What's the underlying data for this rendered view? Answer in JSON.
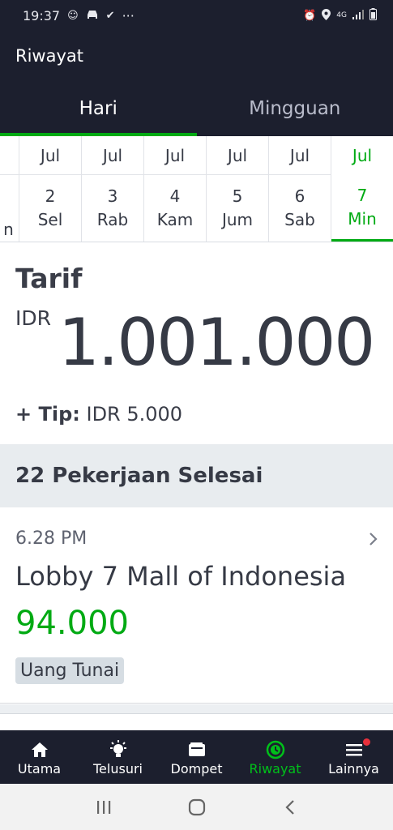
{
  "status_bar": {
    "time": "19:37",
    "more": "···",
    "network": "4G"
  },
  "app_bar": {
    "title": "Riwayat"
  },
  "tabs": [
    {
      "label": "Hari",
      "active": true
    },
    {
      "label": "Mingguan",
      "active": false
    }
  ],
  "dates": [
    {
      "month": "",
      "day": "",
      "weekday": "n"
    },
    {
      "month": "Jul",
      "day": "2",
      "weekday": "Sel"
    },
    {
      "month": "Jul",
      "day": "3",
      "weekday": "Rab"
    },
    {
      "month": "Jul",
      "day": "4",
      "weekday": "Kam"
    },
    {
      "month": "Jul",
      "day": "5",
      "weekday": "Jum"
    },
    {
      "month": "Jul",
      "day": "6",
      "weekday": "Sab"
    },
    {
      "month": "Jul",
      "day": "7",
      "weekday": "Min",
      "selected": true
    }
  ],
  "tarif": {
    "title": "Tarif",
    "currency": "IDR",
    "amount": "1.001.000",
    "tip_label": "+ Tip:",
    "tip_value": "IDR 5.000"
  },
  "jobs": {
    "header": "22 Pekerjaan Selesai",
    "items": [
      {
        "time": "6.28 PM",
        "place": "Lobby 7 Mall of Indonesia",
        "amount": "94.000",
        "badge": "Uang Tunai"
      }
    ]
  },
  "bottom_nav": [
    {
      "label": "Utama",
      "icon": "home-icon"
    },
    {
      "label": "Telusuri",
      "icon": "lightbulb-icon"
    },
    {
      "label": "Dompet",
      "icon": "wallet-icon"
    },
    {
      "label": "Riwayat",
      "icon": "history-icon",
      "active": true
    },
    {
      "label": "Lainnya",
      "icon": "menu-icon",
      "badge_dot": true
    }
  ],
  "colors": {
    "dark": "#1c1f2e",
    "accent_green": "#00aa13",
    "notification_red": "#e8303b"
  }
}
